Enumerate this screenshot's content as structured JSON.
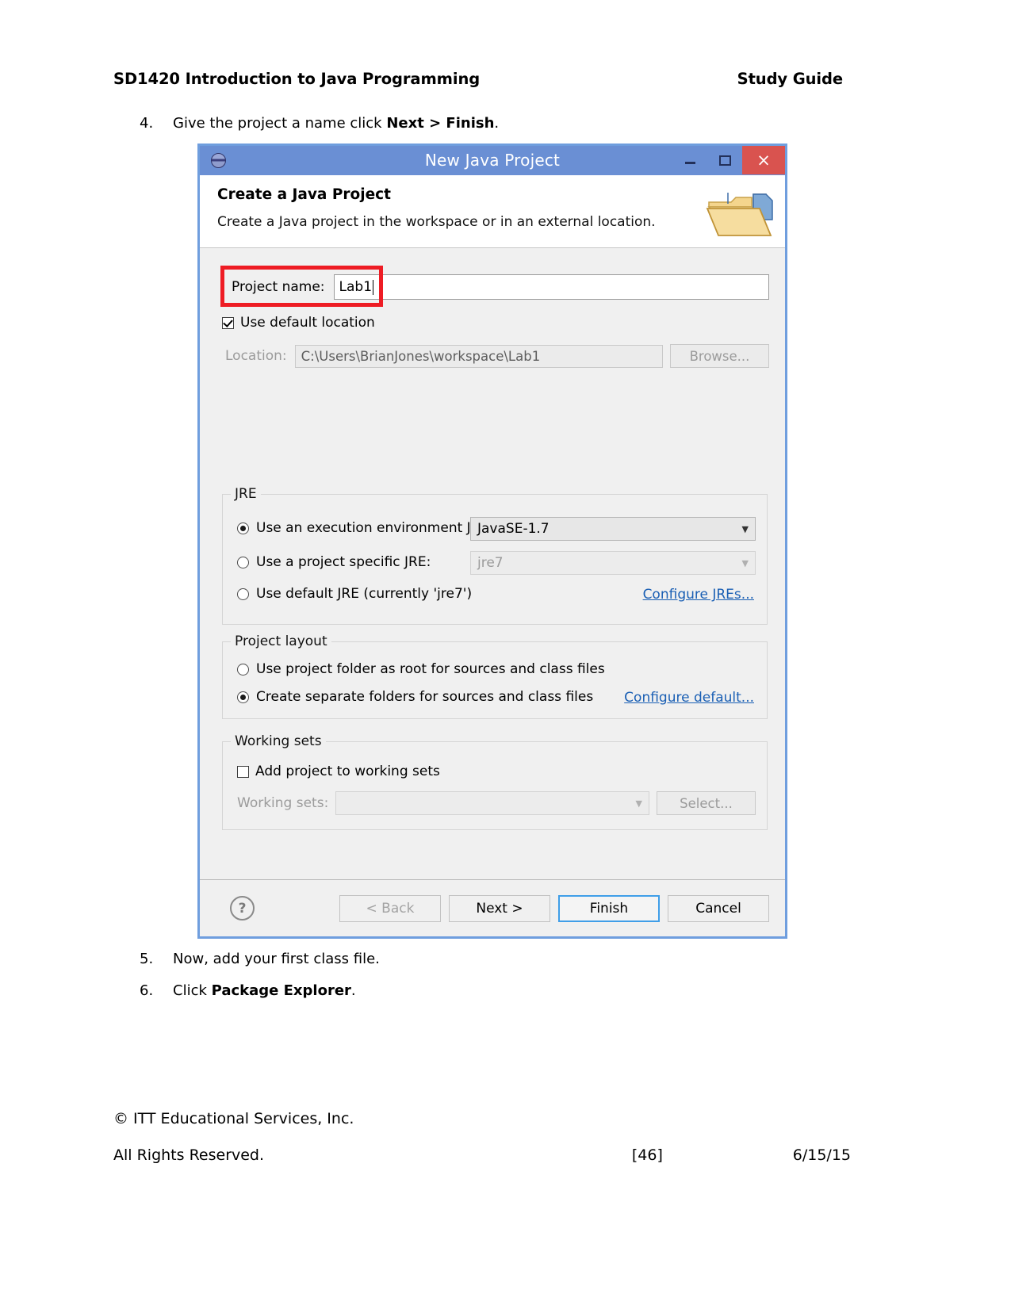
{
  "document": {
    "header": {
      "course_title": "SD1420 Introduction to Java Programming",
      "doc_type": "Study Guide"
    },
    "steps": [
      {
        "number": "4.",
        "text_before": "Give the project a name click ",
        "bold": "Next > Finish",
        "text_after": "."
      },
      {
        "number": "5.",
        "text_before": "Now, add your first class file.",
        "bold": "",
        "text_after": ""
      },
      {
        "number": "6.",
        "text_before": "Click ",
        "bold": "Package Explorer",
        "text_after": "."
      }
    ],
    "footer": {
      "copyright": "© ITT Educational Services, Inc.",
      "rights": "All Rights Reserved.",
      "page": "[46]",
      "date": "6/15/15"
    }
  },
  "dialog": {
    "titlebar": {
      "title": "New Java Project",
      "icon": "eclipse-globe-icon",
      "minimize": "–",
      "maximize": "☐",
      "close": "×"
    },
    "header": {
      "title": "Create a Java Project",
      "subtitle": "Create a Java project in the workspace or in an external location.",
      "banner_icon": "java-project-folder-icon"
    },
    "project_name": {
      "label": "Project name:",
      "value": "Lab1",
      "highlight_color": "#ee1c24"
    },
    "use_default_location": {
      "label": "Use default location",
      "checked": true
    },
    "location": {
      "label": "Location:",
      "value": "C:\\Users\\BrianJones\\workspace\\Lab1",
      "browse_label": "Browse...",
      "disabled": true
    },
    "jre": {
      "legend": "JRE",
      "options": [
        {
          "label": "Use an execution environment JRE:",
          "selected": true
        },
        {
          "label": "Use a project specific JRE:",
          "selected": false
        },
        {
          "label": "Use default JRE (currently 'jre7')",
          "selected": false
        }
      ],
      "execution_env_value": "JavaSE-1.7",
      "specific_jre_value": "jre7",
      "configure_link": "Configure JREs..."
    },
    "project_layout": {
      "legend": "Project layout",
      "options": [
        {
          "label": "Use project folder as root for sources and class files",
          "selected": false
        },
        {
          "label": "Create separate folders for sources and class files",
          "selected": true
        }
      ],
      "configure_link": "Configure default..."
    },
    "working_sets": {
      "legend": "Working sets",
      "add_label": "Add project to working sets",
      "add_checked": false,
      "sets_label": "Working sets:",
      "sets_value": "",
      "select_label": "Select...",
      "disabled": true
    },
    "footer": {
      "help_glyph": "?",
      "back_label": "< Back",
      "next_label": "Next >",
      "finish_label": "Finish",
      "cancel_label": "Cancel"
    }
  }
}
